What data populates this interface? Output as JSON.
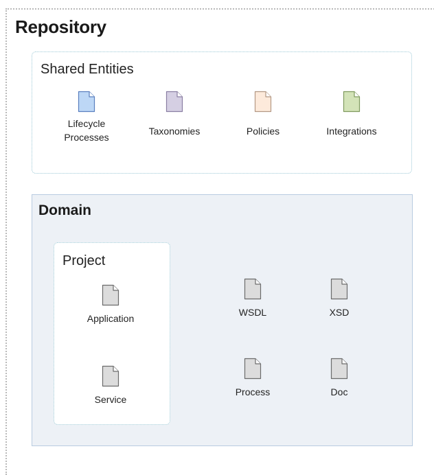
{
  "repository": {
    "title": "Repository"
  },
  "shared_entities": {
    "title": "Shared Entities",
    "items": [
      {
        "line1": "Lifecycle",
        "line2": "Processes",
        "icon": "document-icon",
        "fill": "#bdd7f6",
        "stroke": "#5a7fbf"
      },
      {
        "line1": "Taxonomies",
        "line2": "",
        "icon": "document-icon",
        "fill": "#d5cfe3",
        "stroke": "#8a7fa3"
      },
      {
        "line1": "Policies",
        "line2": "",
        "icon": "document-icon",
        "fill": "#fdeadb",
        "stroke": "#b39884"
      },
      {
        "line1": "Integrations",
        "line2": "",
        "icon": "document-icon",
        "fill": "#d3e3b8",
        "stroke": "#7f9a5e"
      }
    ]
  },
  "domain": {
    "title": "Domain",
    "project": {
      "title": "Project",
      "items": [
        {
          "label": "Application",
          "icon": "document-icon",
          "fill": "#dcdcdc",
          "stroke": "#6b6b6b"
        },
        {
          "label": "Service",
          "icon": "document-icon",
          "fill": "#dcdcdc",
          "stroke": "#6b6b6b"
        }
      ]
    },
    "items": [
      {
        "label": "WSDL",
        "icon": "document-icon",
        "fill": "#dcdcdc",
        "stroke": "#6b6b6b"
      },
      {
        "label": "XSD",
        "icon": "document-icon",
        "fill": "#dcdcdc",
        "stroke": "#6b6b6b"
      },
      {
        "label": "Process",
        "icon": "document-icon",
        "fill": "#dcdcdc",
        "stroke": "#6b6b6b"
      },
      {
        "label": "Doc",
        "icon": "document-icon",
        "fill": "#dcdcdc",
        "stroke": "#6b6b6b"
      }
    ]
  }
}
